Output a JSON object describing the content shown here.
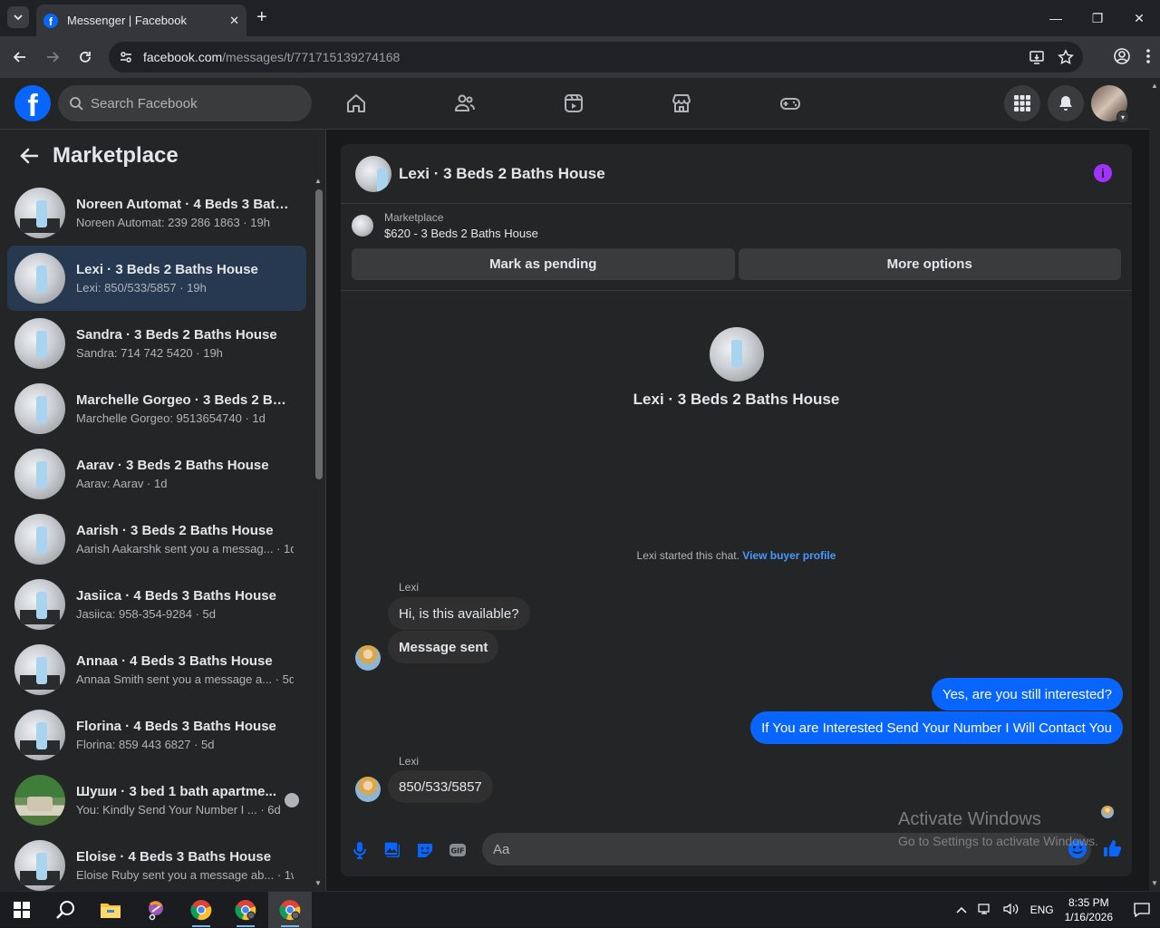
{
  "browser": {
    "tab_title": "Messenger | Facebook",
    "url_host": "facebook.com",
    "url_path": "/messages/t/771715139274168"
  },
  "fb_header": {
    "search_placeholder": "Search Facebook",
    "brand_color": "#0866ff"
  },
  "marketplace": {
    "title": "Marketplace",
    "conversations": [
      {
        "name": "Noreen Automat · 4 Beds 3 Bath...",
        "preview": "Noreen Automat: 239 286 1863 · 19h"
      },
      {
        "name": "Lexi · 3 Beds 2 Baths House",
        "preview": "Lexi: 850/533/5857 · 19h"
      },
      {
        "name": "Sandra · 3 Beds 2 Baths House",
        "preview": "Sandra: 714 742 5420 · 19h"
      },
      {
        "name": "Marchelle Gorgeo · 3 Beds 2 Bat...",
        "preview": "Marchelle Gorgeo: 9513654740 · 1d"
      },
      {
        "name": "Aarav · 3 Beds 2 Baths House",
        "preview": "Aarav: Aarav · 1d"
      },
      {
        "name": "Aarish · 3 Beds 2 Baths House",
        "preview": "Aarish Aakarshk sent you a messag... · 1d"
      },
      {
        "name": "Jasiica · 4 Beds 3 Baths House",
        "preview": "Jasiica: 958-354-9284 · 5d"
      },
      {
        "name": "Annaa · 4 Beds 3 Baths House",
        "preview": "Annaa Smith sent you a message a... · 5d"
      },
      {
        "name": "Florina · 4 Beds 3 Baths House",
        "preview": "Florina: 859 443 6827 · 5d"
      },
      {
        "name": "Шуши · 3 bed 1 bath apartme...",
        "preview": "You: Kindly Send Your Number I ... · 6d"
      },
      {
        "name": "Eloise · 4 Beds 3 Baths House",
        "preview": "Eloise Ruby sent you a message ab... · 1w"
      }
    ]
  },
  "chat": {
    "title": "Lexi · 3 Beds 2 Baths House",
    "listing_category": "Marketplace",
    "listing_price_title": "$620 - 3 Beds 2 Baths House",
    "mark_pending": "Mark as pending",
    "more_options": "More options",
    "intro_title": "Lexi · 3 Beds 2 Baths House",
    "started_text": "Lexi started this chat.",
    "view_profile": "View buyer profile",
    "sender_name": "Lexi",
    "messages": [
      {
        "text": "Hi, is this available?"
      },
      {
        "text": "Message sent"
      },
      {
        "text": "Yes, are you still interested?"
      },
      {
        "text": "If You are Interested Send Your Number I Will Contact You"
      },
      {
        "text": "850/533/5857"
      }
    ],
    "composer_placeholder": "Aa"
  },
  "watermark": {
    "line1": "Activate Windows",
    "line2": "Go to Settings to activate Windows."
  },
  "taskbar": {
    "lang": "ENG",
    "time": "8:35 PM",
    "date": "1/16/2026"
  }
}
